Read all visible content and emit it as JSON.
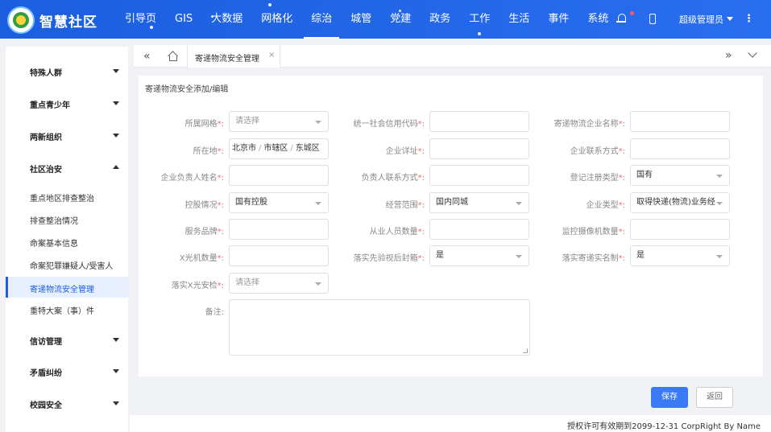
{
  "header": {
    "brand": "智慧社区",
    "nav": [
      "引导页",
      "GIS",
      "大数据",
      "网格化",
      "综治",
      "城管",
      "党建",
      "政务",
      "工作",
      "生活",
      "事件",
      "系统"
    ],
    "active_nav": "综治",
    "admin_label": "超级管理员",
    "kebab": "⋮"
  },
  "sidebar": {
    "groups": [
      {
        "label": "特殊人群"
      },
      {
        "label": "重点青少年"
      },
      {
        "label": "两新组织"
      },
      {
        "label": "社区治安"
      }
    ],
    "items": [
      {
        "label": "重点地区排查整治"
      },
      {
        "label": "排查整治情况"
      },
      {
        "label": "命案基本信息"
      },
      {
        "label": "命案犯罪嫌疑人/受害人"
      },
      {
        "label": "寄递物流安全管理"
      },
      {
        "label": "重特大案（事）件"
      }
    ],
    "groups_after": [
      {
        "label": "信访管理"
      },
      {
        "label": "矛盾纠纷"
      },
      {
        "label": "校园安全"
      }
    ]
  },
  "tabs": {
    "dbl_left": "«",
    "dbl_right": "»",
    "active_tab": "寄递物流安全管理",
    "close": "×"
  },
  "form": {
    "title": "寄递物流安全添加/编辑",
    "fields": {
      "grid": {
        "label": "所属网格",
        "placeholder": "请选择"
      },
      "credit_code": {
        "label": "统一社会信用代码",
        "value": ""
      },
      "company_name": {
        "label": "寄递物流企业名称",
        "value": ""
      },
      "location": {
        "label": "所在地",
        "city": "北京市",
        "district": "市辖区",
        "area": "东城区",
        "sep": "/"
      },
      "address": {
        "label": "企业详址",
        "value": ""
      },
      "contact": {
        "label": "企业联系方式",
        "value": ""
      },
      "leader_name": {
        "label": "企业负责人姓名",
        "value": ""
      },
      "leader_phone": {
        "label": "负责人联系方式",
        "value": ""
      },
      "reg_type": {
        "label": "登记注册类型",
        "value": "国有"
      },
      "holding": {
        "label": "控股情况",
        "value": "国有控股"
      },
      "scope": {
        "label": "经营范围",
        "value": "国内同城"
      },
      "company_type": {
        "label": "企业类型",
        "value": "取得快递(物流)业务经"
      },
      "brand": {
        "label": "服务品牌",
        "value": ""
      },
      "staff_count": {
        "label": "从业人员数量",
        "value": ""
      },
      "camera_count": {
        "label": "监控摄像机数量",
        "value": ""
      },
      "xray_count": {
        "label": "X光机数量",
        "value": ""
      },
      "inspect_before_seal": {
        "label": "落实先验视后封箱",
        "value": "是"
      },
      "real_name": {
        "label": "落实寄递实名制",
        "value": "是"
      },
      "xray_check": {
        "label": "落实X光安检",
        "placeholder": "请选择"
      },
      "remark": {
        "label": "备注",
        "value": ""
      }
    },
    "required_mark": "*",
    "colon": ":"
  },
  "buttons": {
    "save": "保存",
    "back": "返回"
  },
  "footer": {
    "text": "授权许可有效期到2099-12-31 CorpRight By Name"
  }
}
